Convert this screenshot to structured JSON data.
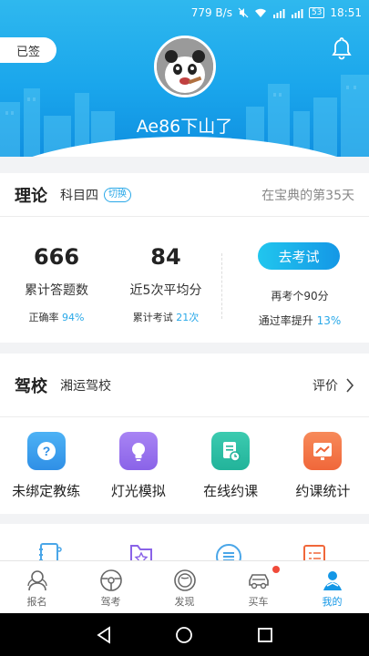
{
  "status_bar": {
    "speed": "779 B/s",
    "battery": "53",
    "time": "18:51"
  },
  "header": {
    "signed_label": "已签",
    "username": "Ae86下山了"
  },
  "theory": {
    "title": "理论",
    "subject": "科目四",
    "switch_label": "切换",
    "days_text": "在宝典的第35天",
    "total_questions": "666",
    "total_questions_label": "累计答题数",
    "accuracy_prefix": "正确率",
    "accuracy_value": "94%",
    "avg_score": "84",
    "avg_score_label": "近5次平均分",
    "exams_prefix": "累计考试",
    "exams_value": "21次",
    "exam_button": "去考试",
    "retake_text": "再考个90分",
    "pass_rate_prefix": "通过率提升",
    "pass_rate_value": "13%"
  },
  "school": {
    "title": "驾校",
    "name": "湘运驾校",
    "review_label": "评价",
    "items": [
      {
        "label": "未绑定教练",
        "icon": "question-icon",
        "color": "#2f8fe6"
      },
      {
        "label": "灯光模拟",
        "icon": "lightbulb-icon",
        "color": "#8a63e8"
      },
      {
        "label": "在线约课",
        "icon": "booking-icon",
        "color": "#22b39a"
      },
      {
        "label": "约课统计",
        "icon": "chart-icon",
        "color": "#f0673a"
      }
    ]
  },
  "tabs": [
    {
      "label": "报名",
      "icon": "signup-icon"
    },
    {
      "label": "驾考",
      "icon": "steering-wheel-icon"
    },
    {
      "label": "发现",
      "icon": "discover-icon"
    },
    {
      "label": "买车",
      "icon": "car-icon"
    },
    {
      "label": "我的",
      "icon": "profile-icon",
      "active": true
    }
  ],
  "colors": {
    "accent": "#1497e6",
    "header": "#1aa6ec"
  }
}
